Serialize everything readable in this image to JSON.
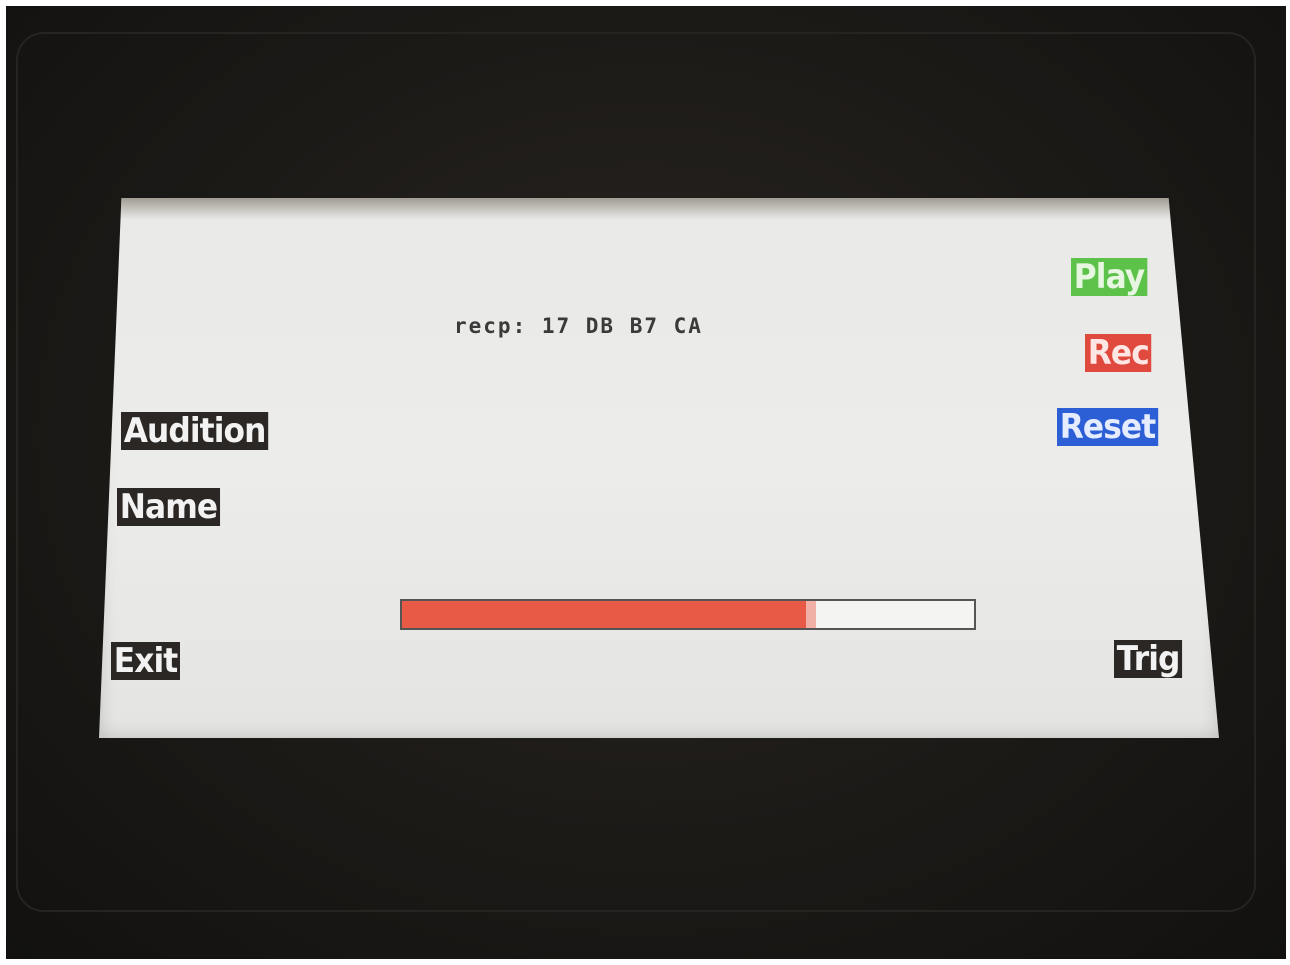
{
  "status": {
    "recp_text": "recp: 17 DB B7 CA"
  },
  "progress": {
    "fraction": 0.71
  },
  "left_buttons": {
    "audition": "Audition",
    "name": "Name",
    "exit": "Exit"
  },
  "right_buttons": {
    "play": "Play",
    "rec": "Rec",
    "reset": "Reset",
    "trig": "Trig"
  },
  "colors": {
    "play": "#5cc24a",
    "rec": "#e0493d",
    "reset": "#2c5fd6",
    "progress": "#e85a45",
    "button_dark": "#2b2724"
  }
}
